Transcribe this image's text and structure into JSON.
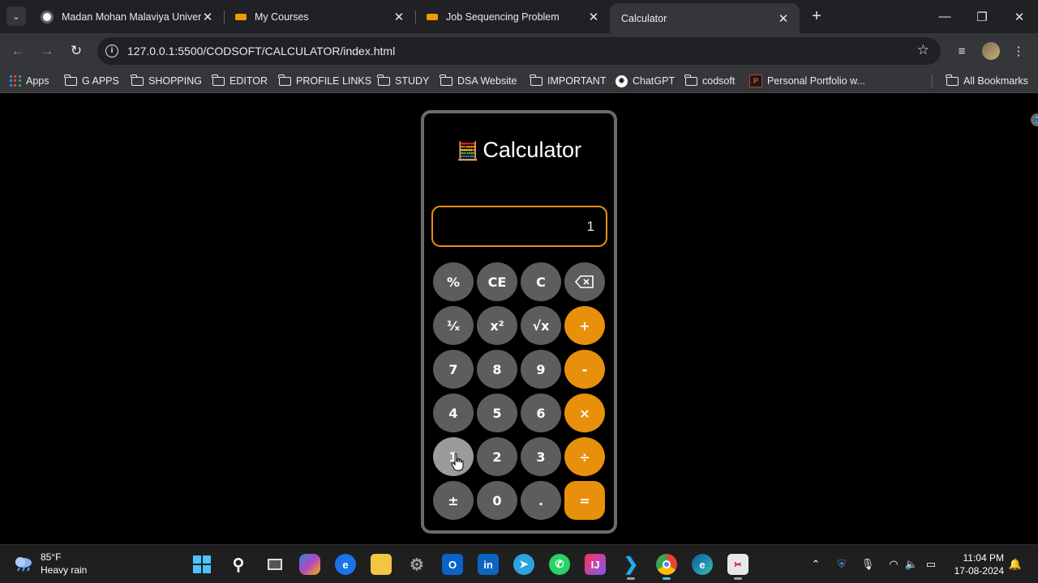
{
  "browser": {
    "tabs": [
      {
        "title": "Madan Mohan Malaviya Univer",
        "active": false
      },
      {
        "title": "My Courses",
        "active": false
      },
      {
        "title": "Job Sequencing Problem",
        "active": false
      },
      {
        "title": "Calculator",
        "active": true
      }
    ],
    "new_tab_glyph": "+",
    "url": "127.0.0.1:5500/CODSOFT/CALCULATOR/index.html",
    "bookmarks": [
      {
        "label": "Apps",
        "icon": "apps-grid-icon"
      },
      {
        "label": "G APPS",
        "icon": "folder-icon"
      },
      {
        "label": "SHOPPING",
        "icon": "folder-icon"
      },
      {
        "label": "EDITOR",
        "icon": "folder-icon"
      },
      {
        "label": "PROFILE LINKS",
        "icon": "folder-icon"
      },
      {
        "label": "STUDY",
        "icon": "folder-icon"
      },
      {
        "label": "DSA Website",
        "icon": "folder-icon"
      },
      {
        "label": "IMPORTANT",
        "icon": "folder-icon"
      },
      {
        "label": "ChatGPT",
        "icon": "chatgpt-icon"
      },
      {
        "label": "codsoft",
        "icon": "folder-icon"
      },
      {
        "label": "Personal Portfolio w...",
        "icon": "portfolio-icon"
      }
    ],
    "all_bookmarks": "All Bookmarks"
  },
  "calculator": {
    "title": "Calculator",
    "display_value": "1",
    "accent_color": "#e8900c",
    "key_color": "#5d5d5d",
    "rows": [
      [
        {
          "label": "%",
          "type": "fn"
        },
        {
          "label": "CE",
          "type": "fn"
        },
        {
          "label": "C",
          "type": "fn"
        },
        {
          "label": "",
          "type": "backspace"
        }
      ],
      [
        {
          "label": "¹⁄ₓ",
          "type": "fn"
        },
        {
          "label": "x²",
          "type": "fn"
        },
        {
          "label": "√x",
          "type": "fn"
        },
        {
          "label": "+",
          "type": "op"
        }
      ],
      [
        {
          "label": "7",
          "type": "num"
        },
        {
          "label": "8",
          "type": "num"
        },
        {
          "label": "9",
          "type": "num"
        },
        {
          "label": "-",
          "type": "op"
        }
      ],
      [
        {
          "label": "4",
          "type": "num"
        },
        {
          "label": "5",
          "type": "num"
        },
        {
          "label": "6",
          "type": "num"
        },
        {
          "label": "×",
          "type": "op"
        }
      ],
      [
        {
          "label": "1",
          "type": "num",
          "hover": true
        },
        {
          "label": "2",
          "type": "num"
        },
        {
          "label": "3",
          "type": "num"
        },
        {
          "label": "÷",
          "type": "op"
        }
      ],
      [
        {
          "label": "±",
          "type": "fn"
        },
        {
          "label": "0",
          "type": "num"
        },
        {
          "label": ".",
          "type": "num"
        },
        {
          "label": "=",
          "type": "eq"
        }
      ]
    ]
  },
  "taskbar": {
    "weather_temp": "85°F",
    "weather_desc": "Heavy rain",
    "time": "11:04 PM",
    "date": "17-08-2024"
  }
}
